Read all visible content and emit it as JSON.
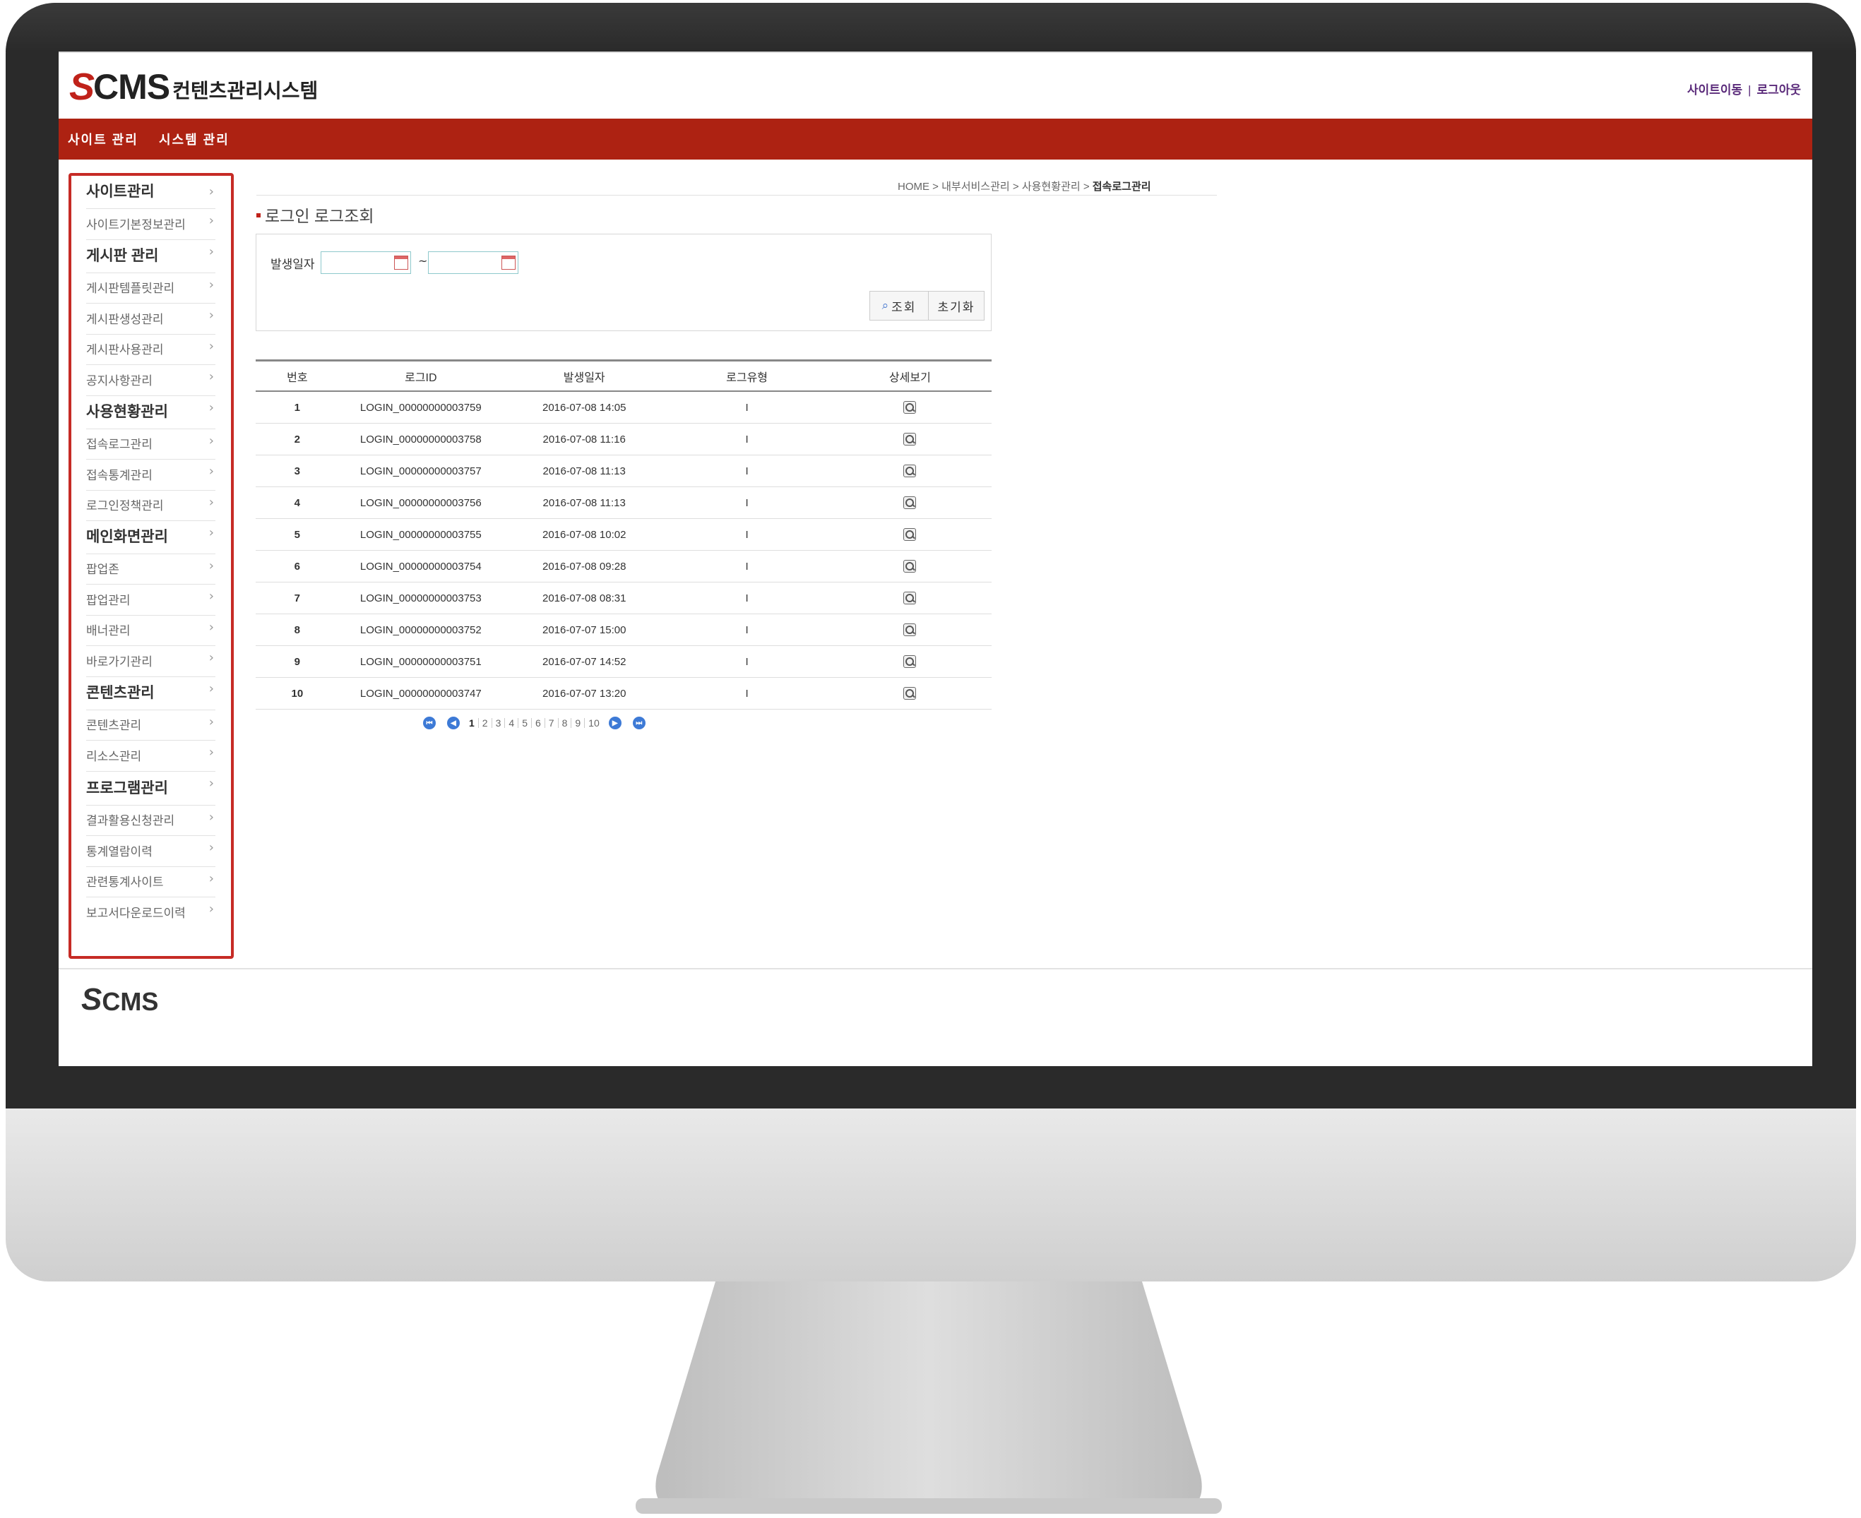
{
  "header": {
    "logo_s": "S",
    "logo_cms": "CMS",
    "logo_sub": "컨텐츠관리시스템",
    "links": [
      "사이트이동",
      "로그아웃"
    ],
    "link_separator": "|"
  },
  "nav": {
    "items": [
      "사이트 관리",
      "시스템 관리"
    ]
  },
  "sidebar": {
    "items": [
      {
        "label": "사이트관리",
        "type": "head"
      },
      {
        "label": "사이트기본정보관리",
        "type": "sub"
      },
      {
        "label": "게시판 관리",
        "type": "head"
      },
      {
        "label": "게시판템플릿관리",
        "type": "sub"
      },
      {
        "label": "게시판생성관리",
        "type": "sub"
      },
      {
        "label": "게시판사용관리",
        "type": "sub"
      },
      {
        "label": "공지사항관리",
        "type": "sub"
      },
      {
        "label": "사용현황관리",
        "type": "head"
      },
      {
        "label": "접속로그관리",
        "type": "sub"
      },
      {
        "label": "접속통계관리",
        "type": "sub"
      },
      {
        "label": "로그인정책관리",
        "type": "sub"
      },
      {
        "label": "메인화면관리",
        "type": "head"
      },
      {
        "label": "팝업존",
        "type": "sub"
      },
      {
        "label": "팝업관리",
        "type": "sub"
      },
      {
        "label": "배너관리",
        "type": "sub"
      },
      {
        "label": "바로가기관리",
        "type": "sub"
      },
      {
        "label": "콘텐츠관리",
        "type": "head"
      },
      {
        "label": "콘텐츠관리",
        "type": "sub"
      },
      {
        "label": "리소스관리",
        "type": "sub"
      },
      {
        "label": "프로그램관리",
        "type": "head"
      },
      {
        "label": "결과활용신청관리",
        "type": "sub"
      },
      {
        "label": "통계열람이력",
        "type": "sub"
      },
      {
        "label": "관련통계사이트",
        "type": "sub"
      },
      {
        "label": "보고서다운로드이력",
        "type": "sub"
      }
    ],
    "arrow": "›"
  },
  "breadcrumb": {
    "items": [
      "HOME",
      "내부서비스관리",
      "사용현황관리"
    ],
    "current": "접속로그관리",
    "separator": ">"
  },
  "page": {
    "title": "로그인 로그조회"
  },
  "search": {
    "label": "발생일자",
    "from_value": "",
    "to_value": "",
    "tilde": "~",
    "search_button": "조회",
    "search_icon": "magnifier-icon",
    "reset_button": "초기화"
  },
  "table": {
    "columns": [
      "번호",
      "로그ID",
      "발생일자",
      "로그유형",
      "상세보기"
    ],
    "rows": [
      {
        "no": "1",
        "id": "LOGIN_00000000003759",
        "date": "2016-07-08 14:05",
        "type": "I"
      },
      {
        "no": "2",
        "id": "LOGIN_00000000003758",
        "date": "2016-07-08 11:16",
        "type": "I"
      },
      {
        "no": "3",
        "id": "LOGIN_00000000003757",
        "date": "2016-07-08 11:13",
        "type": "I"
      },
      {
        "no": "4",
        "id": "LOGIN_00000000003756",
        "date": "2016-07-08 11:13",
        "type": "I"
      },
      {
        "no": "5",
        "id": "LOGIN_00000000003755",
        "date": "2016-07-08 10:02",
        "type": "I"
      },
      {
        "no": "6",
        "id": "LOGIN_00000000003754",
        "date": "2016-07-08 09:28",
        "type": "I"
      },
      {
        "no": "7",
        "id": "LOGIN_00000000003753",
        "date": "2016-07-08 08:31",
        "type": "I"
      },
      {
        "no": "8",
        "id": "LOGIN_00000000003752",
        "date": "2016-07-07 15:00",
        "type": "I"
      },
      {
        "no": "9",
        "id": "LOGIN_00000000003751",
        "date": "2016-07-07 14:52",
        "type": "I"
      },
      {
        "no": "10",
        "id": "LOGIN_00000000003747",
        "date": "2016-07-07 13:20",
        "type": "I"
      }
    ]
  },
  "pagination": {
    "pages": [
      "1",
      "2",
      "3",
      "4",
      "5",
      "6",
      "7",
      "8",
      "9",
      "10"
    ],
    "current": "1",
    "first_icon": "first-page-icon",
    "prev_icon": "prev-page-icon",
    "next_icon": "next-page-icon",
    "last_icon": "last-page-icon"
  },
  "footer": {
    "logo_s": "S",
    "logo_cms": "CMS"
  },
  "colors": {
    "brand_red": "#ad2212",
    "sidebar_border": "#c62b25",
    "link_purple": "#5a2a7a",
    "pager_blue": "#3d7ad6"
  }
}
